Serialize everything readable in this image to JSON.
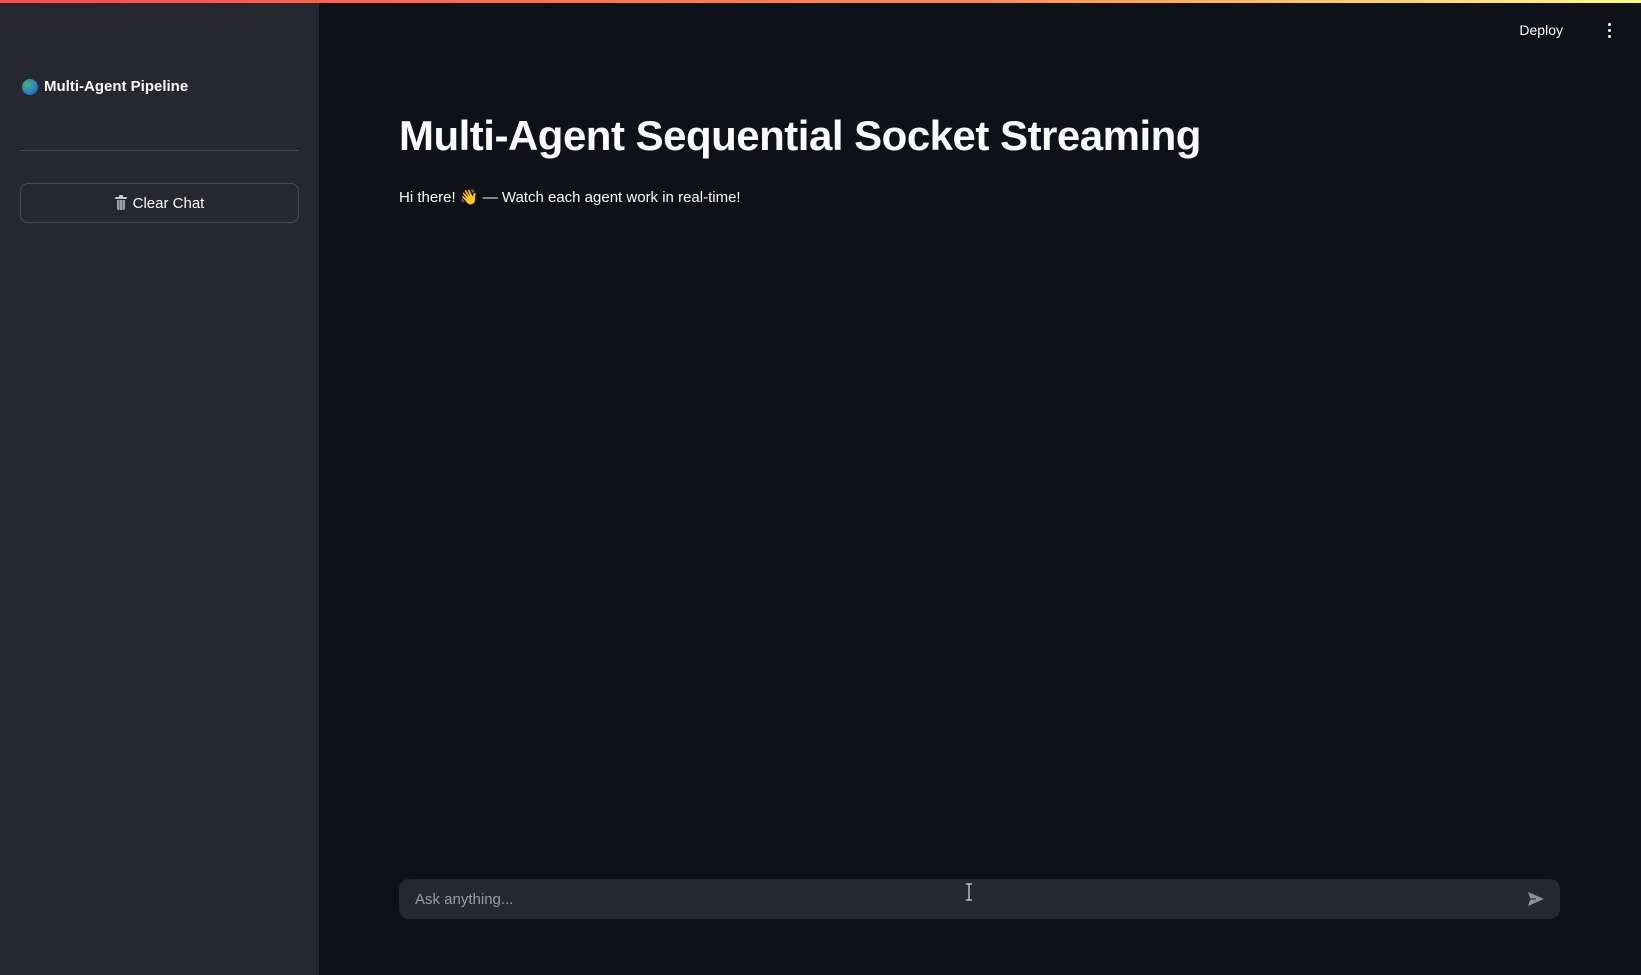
{
  "sidebar": {
    "brand_icon": "globe-icon",
    "brand_title": "Multi-Agent Pipeline",
    "clear_button_icon": "trash-icon",
    "clear_button_label": "Clear Chat"
  },
  "header": {
    "deploy_label": "Deploy",
    "menu_icon": "vertical-dots-icon"
  },
  "main": {
    "title": "Multi-Agent Sequential Socket Streaming",
    "intro": "Hi there! 👋 — Watch each agent work in real-time!"
  },
  "chat_input": {
    "placeholder": "Ask anything...",
    "value": "",
    "send_icon": "send-icon"
  },
  "colors": {
    "background": "#0e1117",
    "sidebar": "#262730",
    "text": "#fafafa",
    "accent_gradient_start": "#ff4b4b",
    "accent_gradient_end": "#fffd80"
  }
}
